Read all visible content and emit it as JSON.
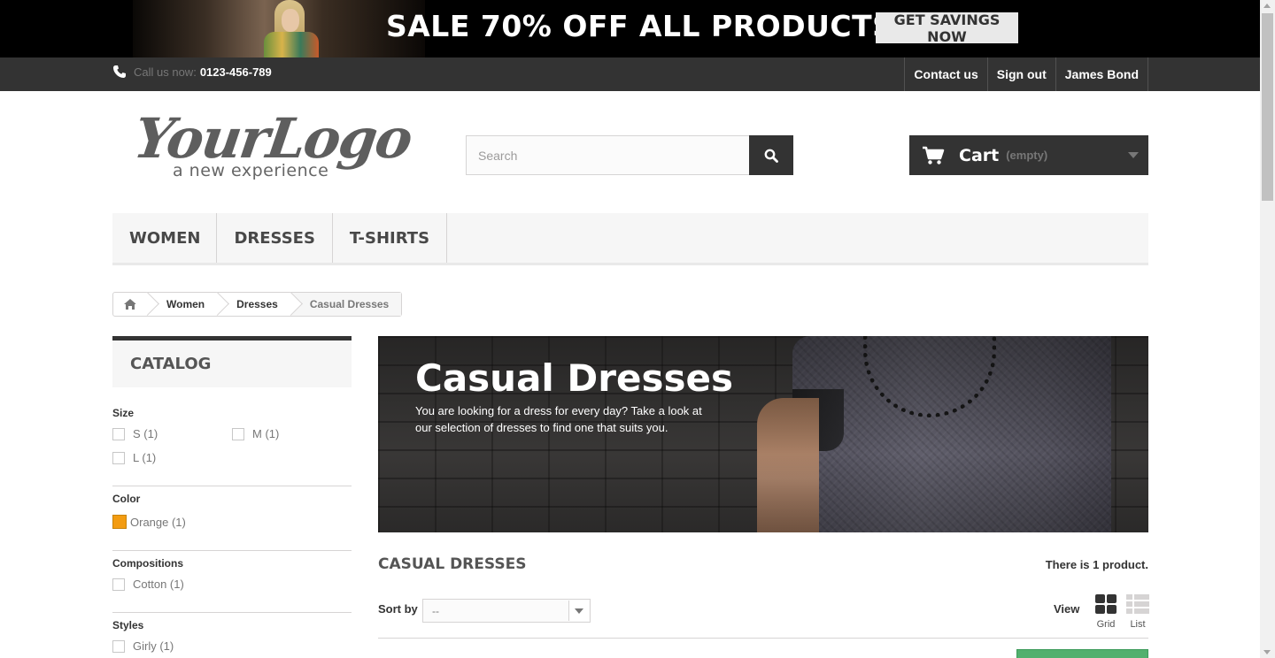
{
  "promo": {
    "headline": "SALE 70% OFF ALL PRODUCTS",
    "cta": "GET SAVINGS NOW"
  },
  "topbar": {
    "call_label": "Call us now:",
    "phone": "0123-456-789",
    "links": [
      "Contact us",
      "Sign out",
      "James Bond"
    ]
  },
  "header": {
    "logo_main": "YourLogo",
    "logo_sub": "a new experience",
    "search_placeholder": "Search",
    "cart_label": "Cart",
    "cart_status": "(empty)"
  },
  "menu": [
    "WOMEN",
    "DRESSES",
    "T-SHIRTS"
  ],
  "breadcrumb": [
    "Women",
    "Dresses",
    "Casual Dresses"
  ],
  "sidebar": {
    "catalog_title": "CATALOG",
    "size_title": "Size",
    "sizes": [
      "S (1)",
      "M (1)",
      "L (1)"
    ],
    "color_title": "Color",
    "colors": [
      {
        "label": "Orange (1)",
        "swatch": "#f39c11"
      }
    ],
    "compositions_title": "Compositions",
    "compositions": [
      "Cotton (1)"
    ],
    "styles_title": "Styles",
    "styles": [
      "Girly (1)"
    ]
  },
  "category": {
    "title": "Casual Dresses",
    "description": "You are looking for a dress for every day? Take a look at our selection of dresses to find one that suits you.",
    "heading": "CASUAL DRESSES",
    "count_prefix": "There is ",
    "count": "1",
    "count_suffix": " product."
  },
  "toolbar": {
    "sort_label": "Sort by",
    "sort_value": "--",
    "view_label": "View",
    "view_grid": "Grid",
    "view_list": "List"
  },
  "colors": {
    "dark_bar": "#333333",
    "accent_green": "#52b06e",
    "menu_bg": "#f6f6f6"
  }
}
